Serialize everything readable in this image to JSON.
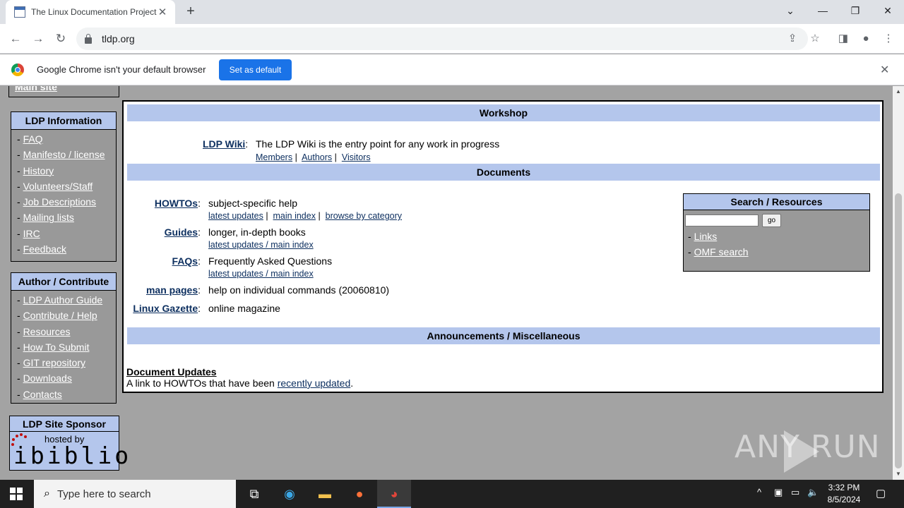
{
  "browser": {
    "tab_title": "The Linux Documentation Project",
    "new_tab_label": "+",
    "url": "tldp.org",
    "infobar_text": "Google Chrome isn't your default browser",
    "infobar_button": "Set as default"
  },
  "sidebar": {
    "prev_item": "Main site",
    "ldp_info": {
      "title": "LDP Information",
      "items": [
        "FAQ",
        "Manifesto / license",
        "History",
        "Volunteers/Staff",
        "Job Descriptions",
        "Mailing lists",
        "IRC",
        "Feedback"
      ]
    },
    "author": {
      "title": "Author / Contribute",
      "items": [
        "LDP Author Guide",
        "Contribute / Help",
        "Resources",
        "How To Submit",
        "GIT repository",
        "Downloads",
        "Contacts"
      ]
    },
    "sponsor": {
      "title": "LDP Site Sponsor",
      "hosted_by": "hosted by",
      "logo_text": "ibiblio"
    }
  },
  "main": {
    "workshop": {
      "title": "Workshop",
      "wiki_link": "LDP Wiki",
      "wiki_desc": "The LDP Wiki is the entry point for any work in progress",
      "wiki_links": [
        "Members",
        "Authors",
        "Visitors"
      ]
    },
    "documents": {
      "title": "Documents",
      "howtos": {
        "label": "HOWTOs",
        "desc": "subject-specific help",
        "links": [
          "latest updates",
          "main index",
          "browse by category"
        ]
      },
      "guides": {
        "label": "Guides",
        "desc": "longer, in-depth books",
        "links": "latest updates / main index"
      },
      "faqs": {
        "label": "FAQs",
        "desc": "Frequently Asked Questions",
        "links": "latest updates / main index"
      },
      "man": {
        "label": "man pages",
        "desc": "help on individual commands (20060810)"
      },
      "gazette": {
        "label": "Linux Gazette",
        "desc": "online magazine"
      }
    },
    "search": {
      "title": "Search / Resources",
      "go": "go",
      "items": [
        "Links",
        "OMF search"
      ]
    },
    "announcements": {
      "title": "Announcements / Miscellaneous",
      "doc_updates_title": "Document Updates",
      "doc_updates_prefix": "A link to HOWTOs that have been ",
      "doc_updates_link": "recently updated",
      "doc_updates_suffix": "."
    }
  },
  "watermark": "ANY RUN",
  "taskbar": {
    "search_placeholder": "Type here to search",
    "time": "3:32 PM",
    "date": "8/5/2024"
  }
}
